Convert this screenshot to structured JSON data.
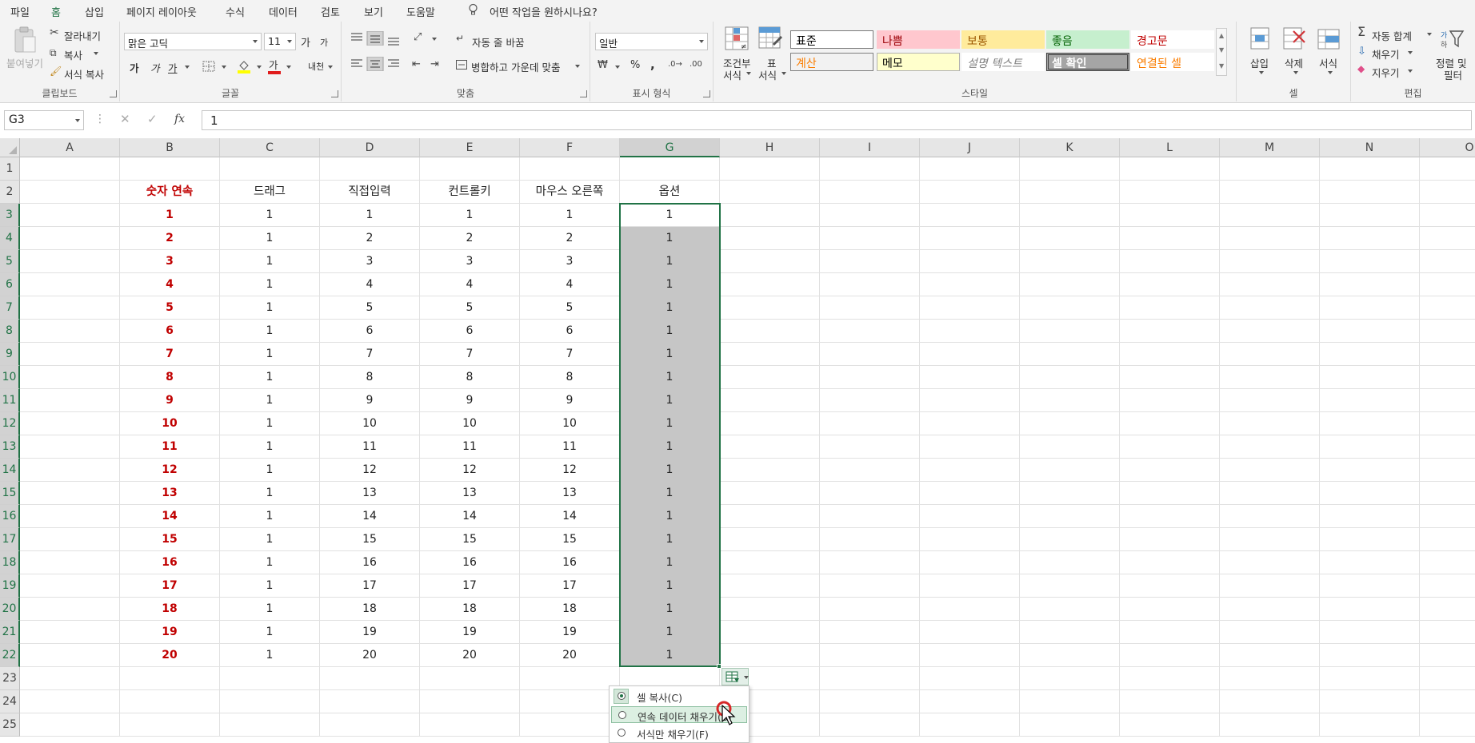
{
  "menu": {
    "items": [
      "파일",
      "홈",
      "삽입",
      "페이지 레이아웃",
      "수식",
      "데이터",
      "검토",
      "보기",
      "도움말"
    ],
    "active_index": 1,
    "tell_me": "어떤 작업을 원하시나요?"
  },
  "ribbon": {
    "clipboard": {
      "paste": "붙여넣기",
      "cut": "잘라내기",
      "copy": "복사",
      "format_painter": "서식 복사",
      "label": "클립보드"
    },
    "font": {
      "name": "맑은 고딕",
      "size": "11",
      "grow": "가",
      "shrink": "가",
      "bold": "가",
      "italic": "가",
      "underline": "가",
      "phonetic": "내천",
      "font_color_letter": "가",
      "label": "글꼴"
    },
    "alignment": {
      "wrap": "자동 줄 바꿈",
      "merge": "병합하고 가운데 맞춤",
      "label": "맞춤"
    },
    "number": {
      "format": "일반",
      "percent": "%",
      "comma": ",",
      "label": "표시 형식"
    },
    "styles": {
      "conditional": [
        "조건부",
        "서식"
      ],
      "table": [
        "표",
        "서식"
      ],
      "cells": [
        {
          "text": "표준",
          "bg": "#ffffff",
          "color": "#000000",
          "border": "#7a7a7a"
        },
        {
          "text": "나쁨",
          "bg": "#ffc7ce",
          "color": "#9c0006",
          "border": "#ffc7ce"
        },
        {
          "text": "보통",
          "bg": "#ffeb9c",
          "color": "#9c5700",
          "border": "#ffeb9c"
        },
        {
          "text": "좋음",
          "bg": "#c6efce",
          "color": "#006100",
          "border": "#c6efce"
        },
        {
          "text": "경고문",
          "bg": "#ffffff",
          "color": "#c00000",
          "border": "#ffffff"
        },
        {
          "text": "계산",
          "bg": "#f2f2f2",
          "color": "#fa7d00",
          "border": "#7f7f7f"
        },
        {
          "text": "메모",
          "bg": "#ffffcc",
          "color": "#000000",
          "border": "#b2b2b2"
        },
        {
          "text": "설명 텍스트",
          "bg": "#ffffff",
          "color": "#7f7f7f",
          "border": "#ffffff"
        },
        {
          "text": "셀 확인",
          "bg": "#a5a5a5",
          "color": "#ffffff",
          "border": "#3f3f3f"
        },
        {
          "text": "연결된 셀",
          "bg": "#ffffff",
          "color": "#fa7d00",
          "border": "#ffffff"
        }
      ],
      "label": "스타일"
    },
    "cells_group": {
      "insert": "삽입",
      "delete": "삭제",
      "format": "서식",
      "label": "셀"
    },
    "editing": {
      "autosum": "자동 합계",
      "fill": "채우기",
      "clear": "지우기",
      "sort": [
        "정렬 및",
        "필터"
      ],
      "label": "편집"
    }
  },
  "formula_bar": {
    "name_box": "G3",
    "value": "1"
  },
  "sheet": {
    "columns": [
      "A",
      "B",
      "C",
      "D",
      "E",
      "F",
      "G",
      "H",
      "I",
      "J",
      "K",
      "L",
      "M",
      "N",
      "O"
    ],
    "selected_column": "G",
    "headers": [
      "숫자 연속",
      "드래그",
      "직접입력",
      "컨트롤키",
      "마우스 오른쪽",
      "옵션"
    ],
    "rows": [
      [
        "1",
        "1",
        "1",
        "1",
        "1",
        "1"
      ],
      [
        "2",
        "1",
        "2",
        "2",
        "2",
        "1"
      ],
      [
        "3",
        "1",
        "3",
        "3",
        "3",
        "1"
      ],
      [
        "4",
        "1",
        "4",
        "4",
        "4",
        "1"
      ],
      [
        "5",
        "1",
        "5",
        "5",
        "5",
        "1"
      ],
      [
        "6",
        "1",
        "6",
        "6",
        "6",
        "1"
      ],
      [
        "7",
        "1",
        "7",
        "7",
        "7",
        "1"
      ],
      [
        "8",
        "1",
        "8",
        "8",
        "8",
        "1"
      ],
      [
        "9",
        "1",
        "9",
        "9",
        "9",
        "1"
      ],
      [
        "10",
        "1",
        "10",
        "10",
        "10",
        "1"
      ],
      [
        "11",
        "1",
        "11",
        "11",
        "11",
        "1"
      ],
      [
        "12",
        "1",
        "12",
        "12",
        "12",
        "1"
      ],
      [
        "13",
        "1",
        "13",
        "13",
        "13",
        "1"
      ],
      [
        "14",
        "1",
        "14",
        "14",
        "14",
        "1"
      ],
      [
        "15",
        "1",
        "15",
        "15",
        "15",
        "1"
      ],
      [
        "16",
        "1",
        "16",
        "16",
        "16",
        "1"
      ],
      [
        "17",
        "1",
        "17",
        "17",
        "17",
        "1"
      ],
      [
        "18",
        "1",
        "18",
        "18",
        "18",
        "1"
      ],
      [
        "19",
        "1",
        "19",
        "19",
        "19",
        "1"
      ],
      [
        "20",
        "1",
        "20",
        "20",
        "20",
        "1"
      ]
    ],
    "row_numbers": [
      "1",
      "2",
      "3",
      "4",
      "5",
      "6",
      "7",
      "8",
      "9",
      "10",
      "11",
      "12",
      "13",
      "14",
      "15",
      "16",
      "17",
      "18",
      "19",
      "20",
      "21",
      "22",
      "23",
      "24",
      "25"
    ]
  },
  "autofill_menu": {
    "items": [
      "셀 복사(C)",
      "연속 데이터 채우기(S)",
      "서식만 채우기(F)"
    ],
    "checked_index": 0,
    "hover_index": 1
  },
  "colors": {
    "accent": "#217346",
    "red_text": "#c00000",
    "selection_fill": "#c6c6c6"
  }
}
